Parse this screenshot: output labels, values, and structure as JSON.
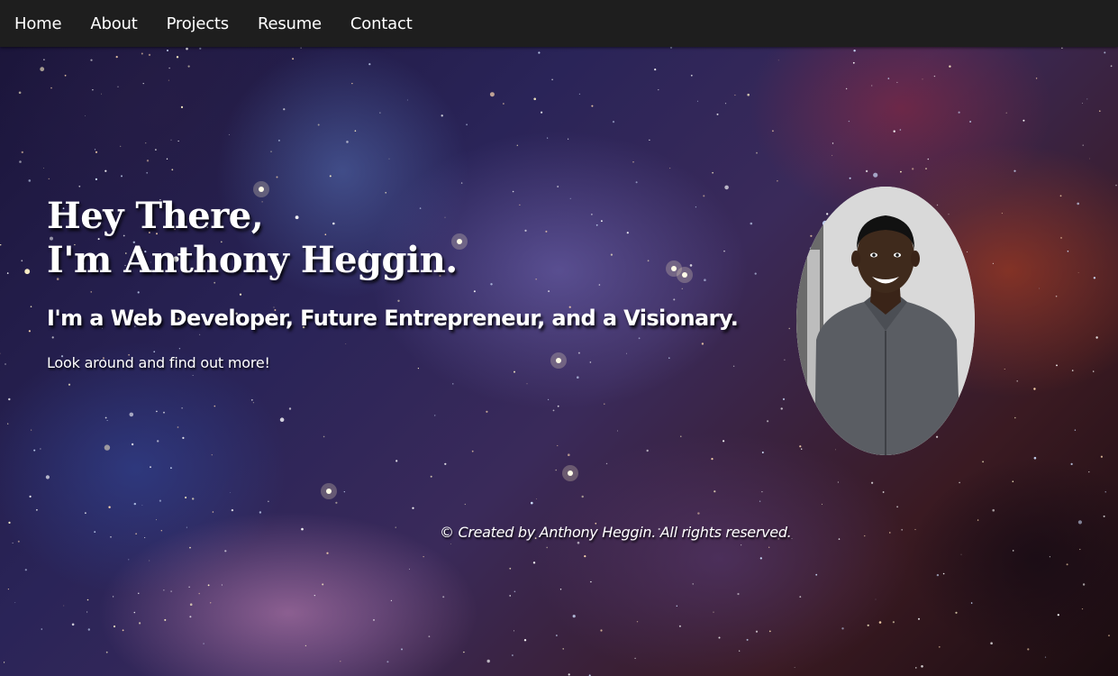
{
  "nav": {
    "items": [
      {
        "label": "Home"
      },
      {
        "label": "About"
      },
      {
        "label": "Projects"
      },
      {
        "label": "Resume"
      },
      {
        "label": "Contact"
      }
    ]
  },
  "hero": {
    "greeting_line1": "Hey There,",
    "greeting_line2": "I'm Anthony Heggin.",
    "tagline": "I'm a Web Developer, Future Entrepreneur, and a Visionary.",
    "intro": "Look around and find out more!"
  },
  "footer": {
    "text": "© Created by Anthony Heggin. All rights reserved."
  },
  "colors": {
    "navbar_bg": "#1e1e1e",
    "text": "#ffffff"
  }
}
